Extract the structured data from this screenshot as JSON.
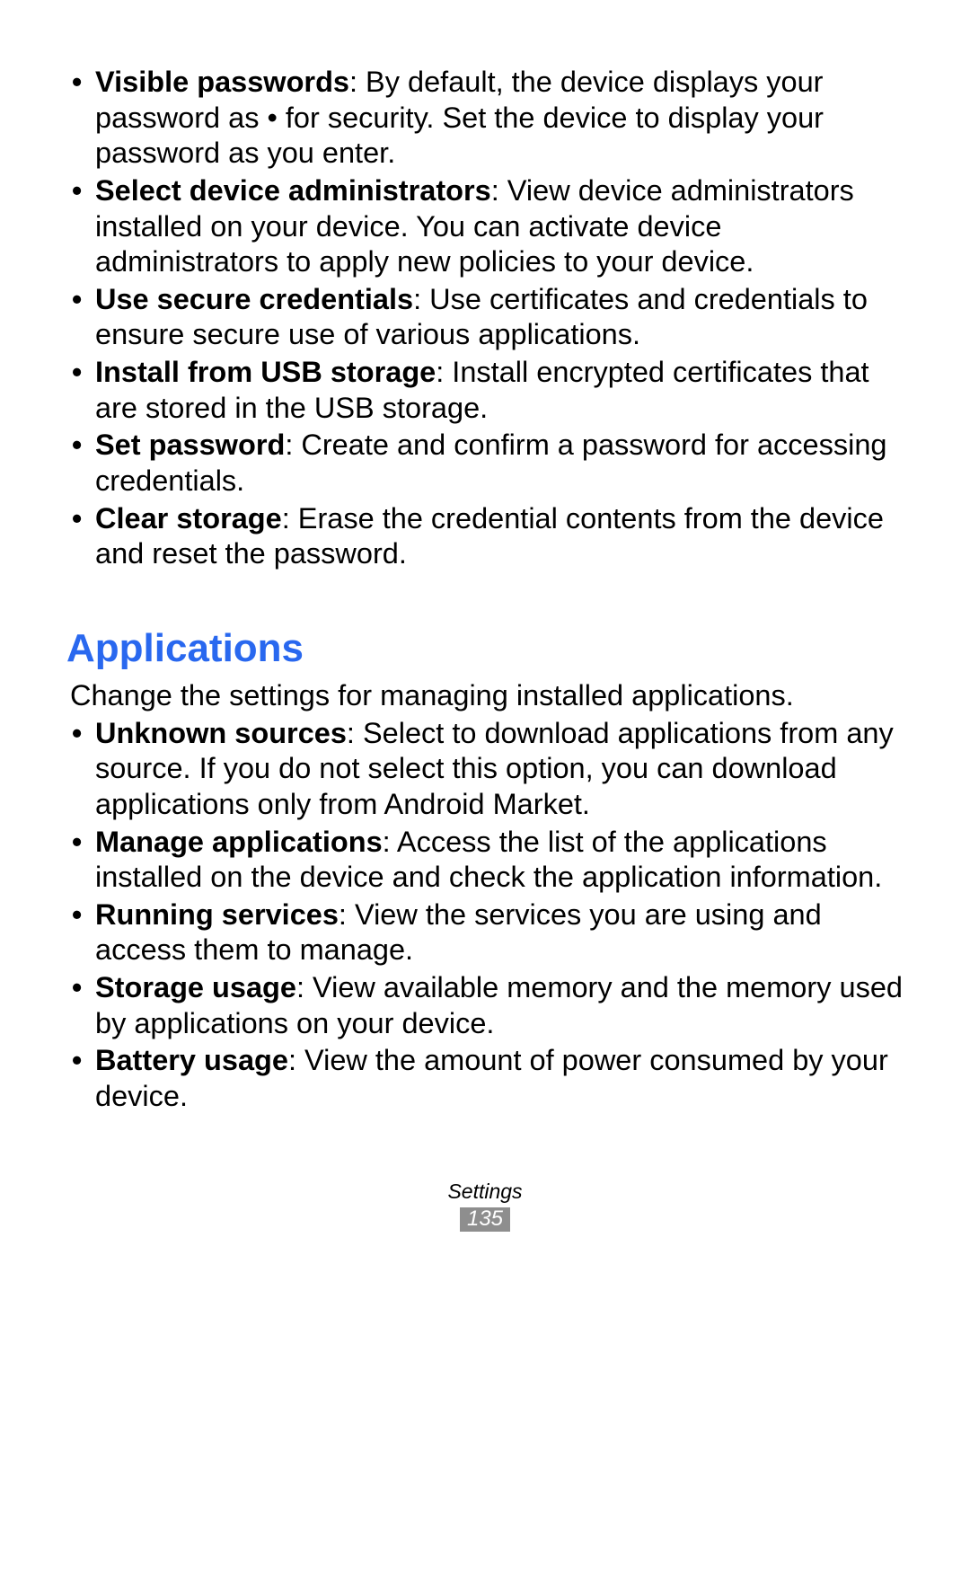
{
  "section1": {
    "items": [
      {
        "bold": "Visible passwords",
        "text": ": By default, the device displays your password as • for security. Set the device to display your password as you enter."
      },
      {
        "bold": "Select device administrators",
        "text": ": View device administrators installed on your device. You can activate device administrators to apply new policies to your device."
      },
      {
        "bold": "Use secure credentials",
        "text": ": Use certificates and credentials to ensure secure use of various applications."
      },
      {
        "bold": "Install from USB storage",
        "text": ": Install encrypted certificates that are stored in the USB storage."
      },
      {
        "bold": "Set password",
        "text": ": Create and confirm a password for accessing credentials."
      },
      {
        "bold": "Clear storage",
        "text": ": Erase the credential contents from the device and reset the password."
      }
    ]
  },
  "section2": {
    "heading": "Applications",
    "intro": "Change the settings for managing installed applications.",
    "items": [
      {
        "bold": "Unknown sources",
        "text": ": Select to download applications from any source. If you do not select this option, you can download applications only from Android Market."
      },
      {
        "bold": "Manage applications",
        "text": ": Access the list of the applications installed on the device and check the application information."
      },
      {
        "bold": "Running services",
        "text": ": View the services you are using and access them to manage."
      },
      {
        "bold": "Storage usage",
        "text": ": View available memory and the memory used by applications on your device."
      },
      {
        "bold": "Battery usage",
        "text": ": View the amount of power consumed by your device."
      }
    ]
  },
  "footer": {
    "label": "Settings",
    "page": "135"
  }
}
